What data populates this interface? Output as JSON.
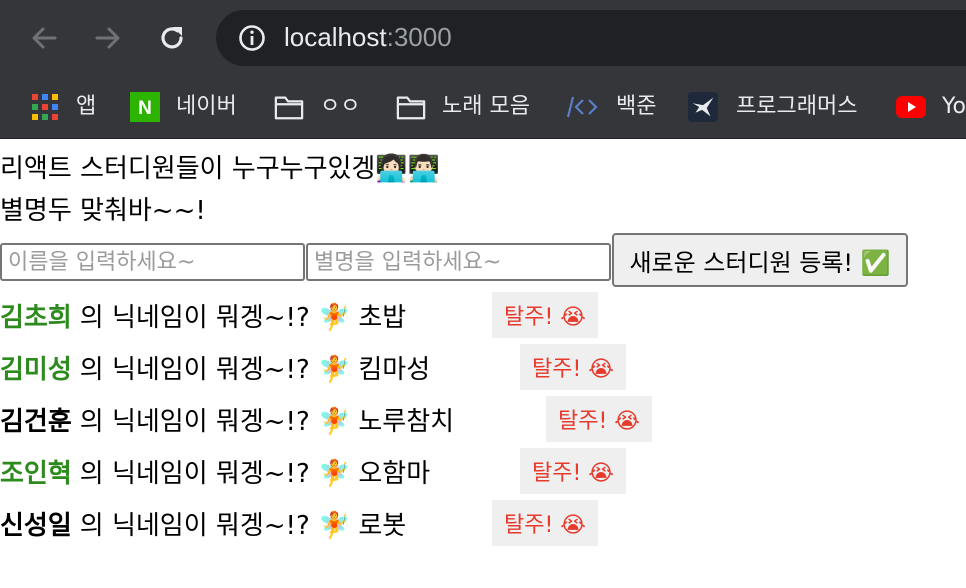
{
  "browser": {
    "url_host": "localhost",
    "url_port": ":3000",
    "bookmarks": [
      {
        "icon": "apps-grid-icon",
        "label": "앱"
      },
      {
        "icon": "naver-icon",
        "label": "네이버"
      },
      {
        "icon": "folder-icon",
        "label": "ㅇㅇ"
      },
      {
        "icon": "folder-icon",
        "label": "노래 모음"
      },
      {
        "icon": "code-icon",
        "label": "백준"
      },
      {
        "icon": "programmers-icon",
        "label": "프로그래머스"
      },
      {
        "icon": "youtube-icon",
        "label": "Yo"
      }
    ],
    "naver_logo_letter": "N"
  },
  "header": {
    "line1": "리액트 스터디원들이 누구누구있겡👩🏻‍💻👨🏻‍💻",
    "line2": "별명두 맞춰바~~!"
  },
  "form": {
    "name_placeholder": "이름을 입력하세요~",
    "nick_placeholder": "별명을 입력하세요~",
    "register_label": "새로운 스터디원 등록! ✅"
  },
  "members": [
    {
      "name": "김초희",
      "color": "#2d8a1d",
      "middle": "의 닉네임이 뭐겡~!? 🧚",
      "nickname": "초밥",
      "leave": "탈주! 😭"
    },
    {
      "name": "김미성",
      "color": "#2d8a1d",
      "middle": "의 닉네임이 뭐겡~!? 🧚",
      "nickname": "킴마성",
      "leave": "탈주! 😭"
    },
    {
      "name": "김건훈",
      "color": "#000000",
      "middle": "의 닉네임이 뭐겡~!? 🧚",
      "nickname": "노루참치",
      "leave": "탈주! 😭"
    },
    {
      "name": "조인혁",
      "color": "#2d8a1d",
      "middle": "의 닉네임이 뭐겡~!? 🧚",
      "nickname": "오함마",
      "leave": "탈주! 😭"
    },
    {
      "name": "신성일",
      "color": "#000000",
      "middle": "의 닉네임이 뭐겡~!? 🧚",
      "nickname": "로봇",
      "leave": "탈주! 😭"
    }
  ]
}
